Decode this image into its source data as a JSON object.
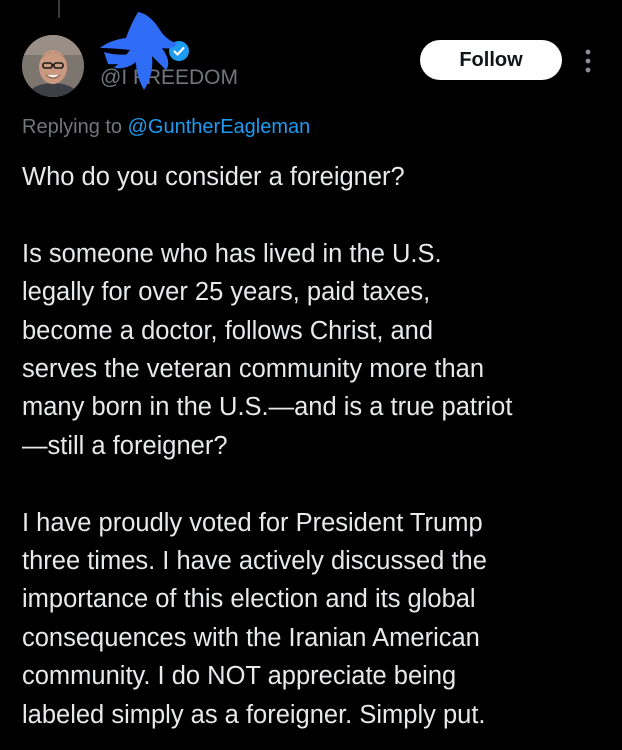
{
  "author": {
    "display_name": "",
    "handle": "@I     FREEDOM",
    "avatar_icon": "profile-photo",
    "verified_icon": "verified-badge-icon",
    "redaction_color": "#2f6df6"
  },
  "actions": {
    "follow_label": "Follow",
    "more_icon": "more-vertical-icon"
  },
  "reply": {
    "prefix": "Replying to ",
    "mention": "@GuntherEagleman"
  },
  "tweet": {
    "p1": {
      "lines": [
        "Who do you consider a foreigner?"
      ]
    },
    "p2": {
      "lines": [
        "Is someone who has lived in the U.S.",
        "legally for over 25 years, paid taxes,",
        "become a doctor, follows Christ, and",
        "serves the veteran community more than",
        "many born in the U.S.—and is a true patriot",
        "—still a foreigner?"
      ]
    },
    "p3": {
      "lines": [
        "I have proudly voted for President Trump",
        "three times. I have actively discussed the",
        "importance of this election and its global",
        "consequences with the Iranian American",
        "community. I do NOT appreciate being",
        "labeled simply as a foreigner. Simply put."
      ]
    }
  },
  "colors": {
    "background": "#000000",
    "text": "#e7e9ea",
    "muted": "#71767b",
    "link": "#1d9bf0",
    "button_bg": "#ffffff"
  }
}
